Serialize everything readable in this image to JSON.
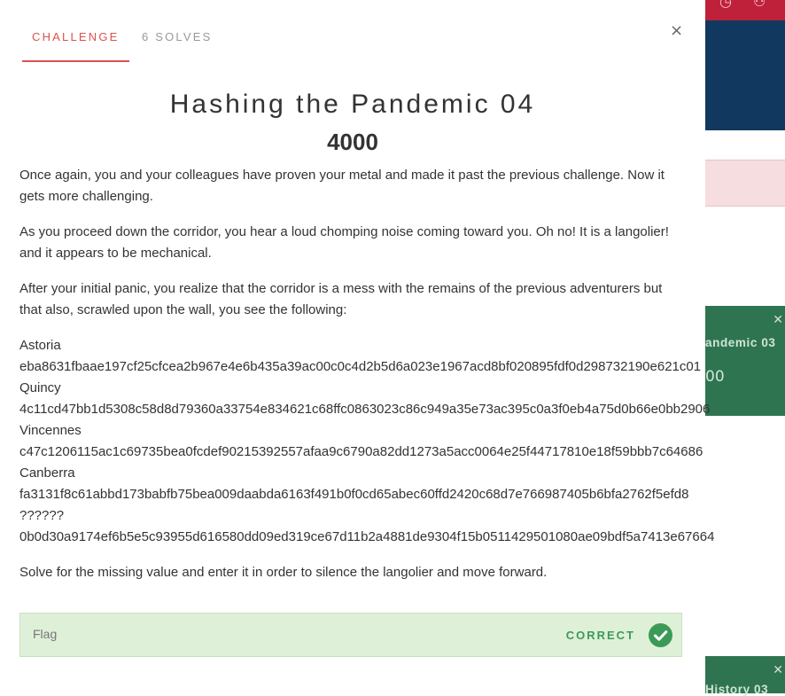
{
  "background": {
    "top_icons": [
      "clock-icon",
      "users-icon"
    ],
    "cards": [
      {
        "title": "andemic 03",
        "points": "00"
      },
      {
        "title": "History 03"
      }
    ]
  },
  "modal": {
    "tabs": [
      {
        "label": "CHALLENGE",
        "active": true
      },
      {
        "label": "6 SOLVES",
        "active": false
      }
    ],
    "close_label": "×",
    "title": "Hashing the Pandemic 04",
    "points": "4000",
    "paragraphs": [
      "Once again, you and your colleagues have proven your metal and made it past the previous challenge. Now it gets more challenging.",
      "As you proceed down the corridor, you hear a loud chomping noise coming toward you. Oh no! It is a langolier! and it appears to be mechanical.",
      "After your initial panic, you realize that the corridor is a mess with the remains of the previous adventurers but that also, scrawled upon the wall, you see the following:"
    ],
    "hash_lines": [
      "Astoria",
      "eba8631fbaae197cf25cfcea2b967e4e6b435a39ac00c0c4d2b5d6a023e1967acd8bf020895fdf0d298732190e621c01",
      "Quincy",
      "4c11cd47bb1d5308c58d8d79360a33754e834621c68ffc0863023c86c949a35e73ac395c0a3f0eb4a75d0b66e0bb2906",
      "Vincennes",
      "c47c1206115ac1c69735bea0fcdef90215392557afaa9c6790a82dd1273a5acc0064e25f44717810e18f59bbb7c64686",
      "Canberra",
      "fa3131f8c61abbd173babfb75bea009daabda6163f491b0f0cd65abec60ffd2420c68d7e766987405b6bfa2762f5efd8",
      "??????",
      "0b0d30a9174ef6b5e5c93955d616580dd09ed319ce67d11b2a4881de9304f15b0511429501080ae09bdf5a7413e67664"
    ],
    "closing": "Solve for the missing value and enter it in order to silence the langolier and move forward.",
    "flag": {
      "placeholder": "Flag",
      "status": "CORRECT",
      "status_color": "#3c9a57"
    }
  }
}
